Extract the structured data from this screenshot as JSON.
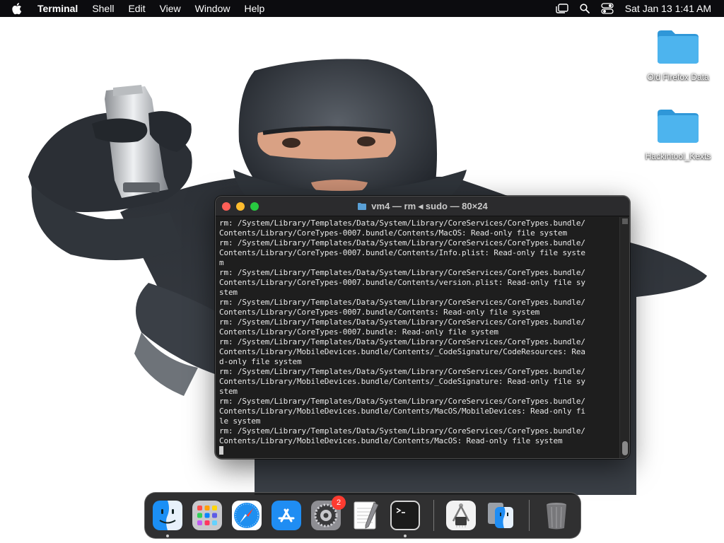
{
  "menubar": {
    "app_name": "Terminal",
    "menus": [
      "Shell",
      "Edit",
      "View",
      "Window",
      "Help"
    ],
    "clock": "Sat Jan 13  1:41 AM"
  },
  "desktop": {
    "icons": [
      {
        "label": "Old Firefox Data",
        "icon": "folder-icon"
      },
      {
        "label": "Hackintool_Kexts",
        "icon": "folder-icon"
      }
    ]
  },
  "terminal": {
    "title": "vm4 — rm ◂ sudo — 80×24",
    "lines": [
      "rm: /System/Library/Templates/Data/System/Library/CoreServices/CoreTypes.bundle/",
      "Contents/Library/CoreTypes-0007.bundle/Contents/MacOS: Read-only file system",
      "rm: /System/Library/Templates/Data/System/Library/CoreServices/CoreTypes.bundle/",
      "Contents/Library/CoreTypes-0007.bundle/Contents/Info.plist: Read-only file syste",
      "m",
      "rm: /System/Library/Templates/Data/System/Library/CoreServices/CoreTypes.bundle/",
      "Contents/Library/CoreTypes-0007.bundle/Contents/version.plist: Read-only file sy",
      "stem",
      "rm: /System/Library/Templates/Data/System/Library/CoreServices/CoreTypes.bundle/",
      "Contents/Library/CoreTypes-0007.bundle/Contents: Read-only file system",
      "rm: /System/Library/Templates/Data/System/Library/CoreServices/CoreTypes.bundle/",
      "Contents/Library/CoreTypes-0007.bundle: Read-only file system",
      "rm: /System/Library/Templates/Data/System/Library/CoreServices/CoreTypes.bundle/",
      "Contents/Library/MobileDevices.bundle/Contents/_CodeSignature/CodeResources: Rea",
      "d-only file system",
      "rm: /System/Library/Templates/Data/System/Library/CoreServices/CoreTypes.bundle/",
      "Contents/Library/MobileDevices.bundle/Contents/_CodeSignature: Read-only file sy",
      "stem",
      "rm: /System/Library/Templates/Data/System/Library/CoreServices/CoreTypes.bundle/",
      "Contents/Library/MobileDevices.bundle/Contents/MacOS/MobileDevices: Read-only fi",
      "le system",
      "rm: /System/Library/Templates/Data/System/Library/CoreServices/CoreTypes.bundle/",
      "Contents/Library/MobileDevices.bundle/Contents/MacOS: Read-only file system"
    ]
  },
  "dock": {
    "items": [
      {
        "name": "finder",
        "icon": "finder-icon",
        "running": true
      },
      {
        "name": "launchpad",
        "icon": "launchpad-icon",
        "running": false
      },
      {
        "name": "safari",
        "icon": "safari-icon",
        "running": false
      },
      {
        "name": "app-store",
        "icon": "app-store-icon",
        "running": false
      },
      {
        "name": "system-settings",
        "icon": "settings-icon",
        "running": false,
        "badge": "2"
      },
      {
        "name": "textedit",
        "icon": "textedit-icon",
        "running": false
      },
      {
        "name": "terminal",
        "icon": "terminal-icon",
        "running": true
      }
    ],
    "recent_items": [
      {
        "name": "system-information",
        "icon": "system-information-icon"
      },
      {
        "name": "migration-assistant",
        "icon": "migration-assistant-icon"
      }
    ],
    "trash": {
      "name": "trash",
      "icon": "trash-icon"
    },
    "badge_color": "#ff3b30"
  },
  "colors": {
    "menubar_bg": "#0c0c0f",
    "terminal_bg": "#1e1e1e",
    "terminal_text": "#e8e8e8",
    "folder_blue": "#39a8e6"
  }
}
